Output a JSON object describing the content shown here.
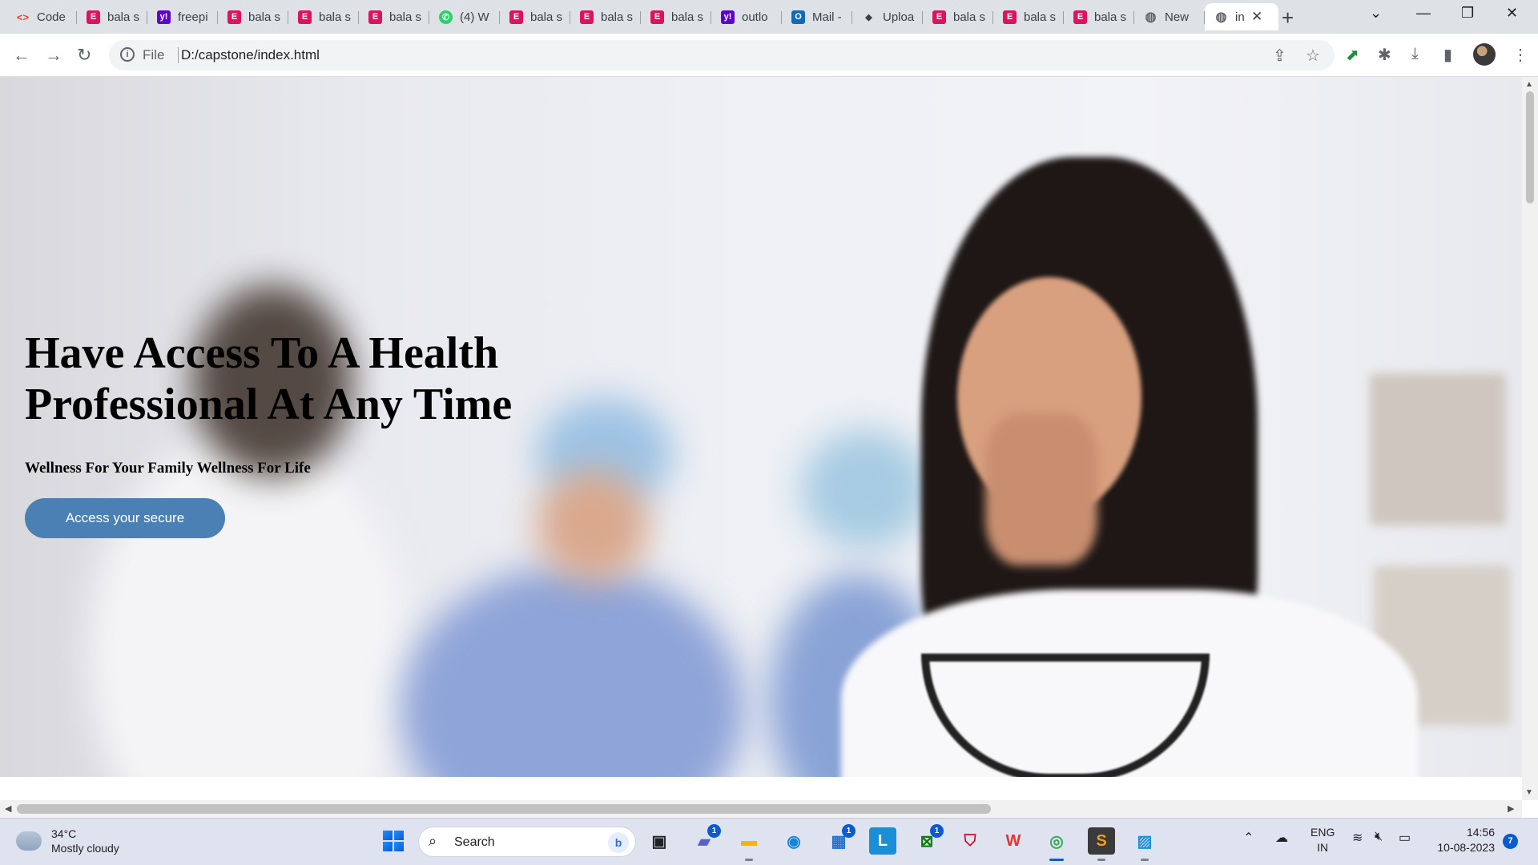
{
  "browser": {
    "tabs": [
      {
        "icon": "code-icon",
        "label": "Code"
      },
      {
        "icon": "e-icon",
        "label": "bala s"
      },
      {
        "icon": "yahoo-icon",
        "label": "freepi"
      },
      {
        "icon": "e-icon",
        "label": "bala s"
      },
      {
        "icon": "e-icon",
        "label": "bala s"
      },
      {
        "icon": "e-icon",
        "label": "bala s"
      },
      {
        "icon": "whatsapp-icon",
        "label": "(4) W"
      },
      {
        "icon": "e-icon",
        "label": "bala s"
      },
      {
        "icon": "e-icon",
        "label": "bala s"
      },
      {
        "icon": "e-icon",
        "label": "bala s"
      },
      {
        "icon": "yahoo-icon",
        "label": "outlo"
      },
      {
        "icon": "outlook-icon",
        "label": "Mail -"
      },
      {
        "icon": "upload-icon",
        "label": "Uploa"
      },
      {
        "icon": "e-icon",
        "label": "bala s"
      },
      {
        "icon": "e-icon",
        "label": "bala s"
      },
      {
        "icon": "e-icon",
        "label": "bala s"
      },
      {
        "icon": "globe-icon",
        "label": "New"
      },
      {
        "icon": "globe-icon",
        "label": "in",
        "active": true
      }
    ],
    "address": {
      "scheme_label": "File",
      "url": "D:/capstone/index.html"
    }
  },
  "page": {
    "headline": "Have Access To A Health Professional At Any Time",
    "subheadline": "Wellness For Your Family Wellness For Life",
    "cta_label": "Access your secure"
  },
  "taskbar": {
    "weather": {
      "temp": "34°C",
      "condition": "Mostly cloudy"
    },
    "search_placeholder": "Search",
    "badges": {
      "chat": "1",
      "store": "1",
      "xbox": "1"
    },
    "language": {
      "line1": "ENG",
      "line2": "IN"
    },
    "clock": {
      "time": "14:56",
      "date": "10-08-2023"
    },
    "notifications": "7"
  },
  "colors": {
    "accent": "#4a80b4",
    "tab_e": "#e0115f",
    "tab_yahoo": "#5f01d1"
  }
}
